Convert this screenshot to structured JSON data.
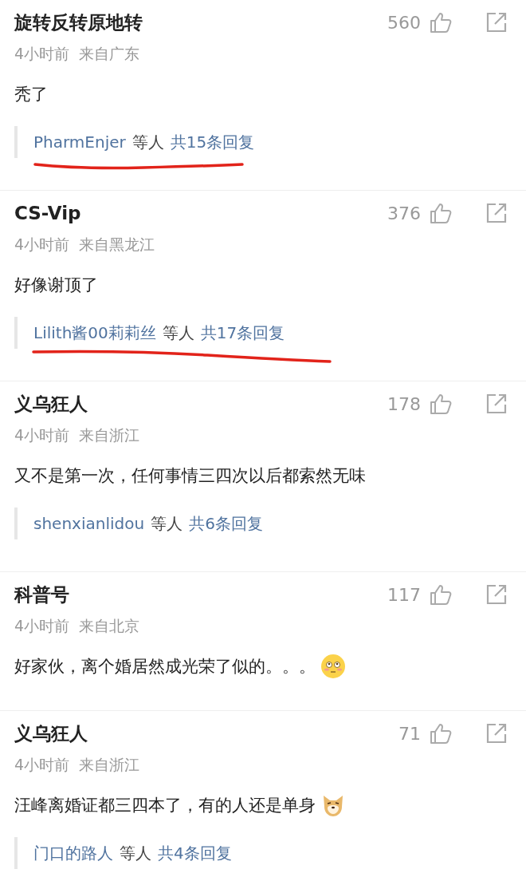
{
  "comments": [
    {
      "user": "旋转反转原地转",
      "likes": "560",
      "time": "4小时前",
      "location": "来自广东",
      "text": "秃了",
      "reply": {
        "user": "PharmEnjer",
        "others": "等人",
        "count": "共15条回复",
        "underlined": true
      }
    },
    {
      "user": "CS-Vip",
      "likes": "376",
      "time": "4小时前",
      "location": "来自黑龙江",
      "text": "好像谢顶了",
      "reply": {
        "user": "Lilith酱00莉莉丝",
        "others": "等人",
        "count": "共17条回复",
        "underlined": true
      }
    },
    {
      "user": "义乌狂人",
      "likes": "178",
      "time": "4小时前",
      "location": "来自浙江",
      "text": "又不是第一次，任何事情三四次以后都索然无味",
      "reply": {
        "user": "shenxianlidou",
        "others": "等人",
        "count": "共6条回复",
        "underlined": false
      }
    },
    {
      "user": "科普号",
      "likes": "117",
      "time": "4小时前",
      "location": "来自北京",
      "text": "好家伙，离个婚居然成光荣了似的。。。",
      "emoji": {
        "kind": "face"
      }
    },
    {
      "user": "义乌狂人",
      "likes": "71",
      "time": "4小时前",
      "location": "来自浙江",
      "text": "汪峰离婚证都三四本了，有的人还是单身",
      "emoji": {
        "kind": "dog"
      },
      "reply": {
        "user": "门口的路人",
        "others": "等人",
        "count": "共4条回复",
        "underlined": false
      }
    }
  ]
}
